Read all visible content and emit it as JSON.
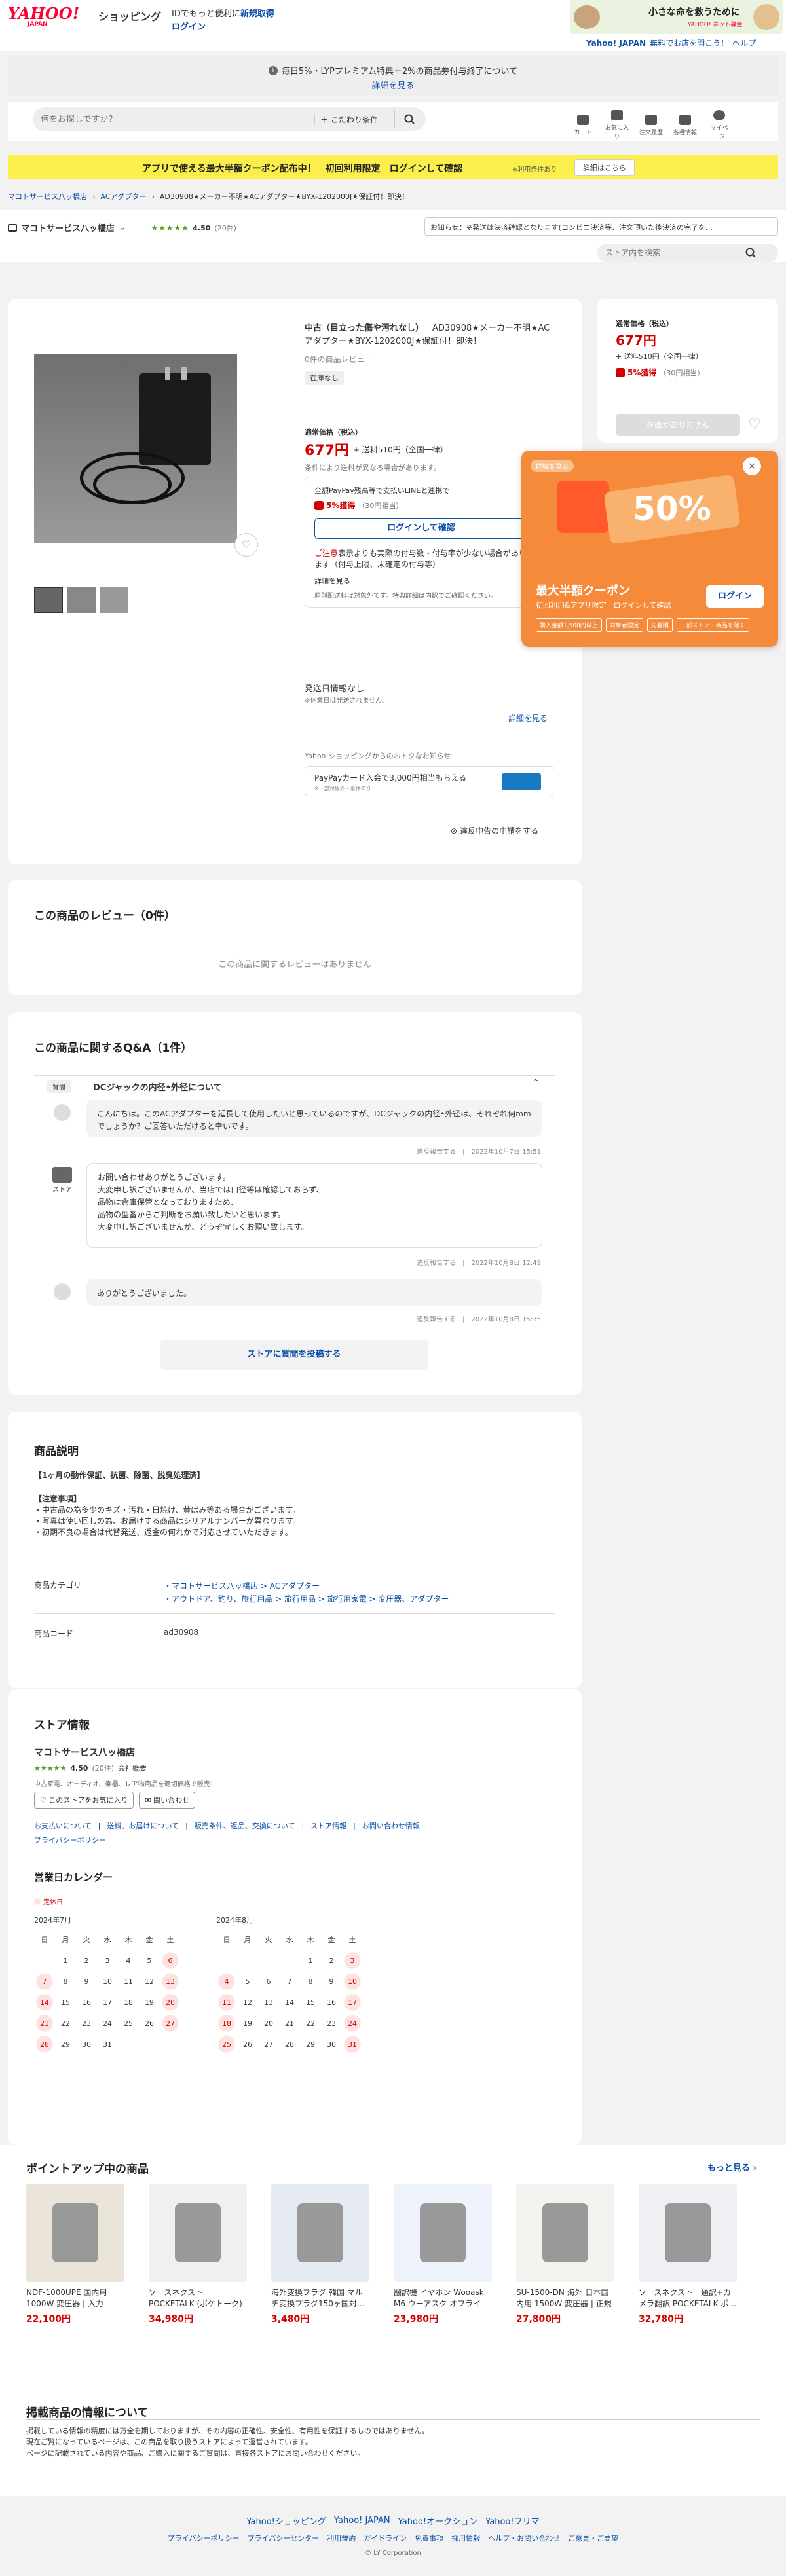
{
  "header": {
    "logo_main": "YAHOO!",
    "logo_sub": "JAPAN",
    "logo_shop": "ショッピング",
    "promo_line1": "IDでもっと便利に",
    "promo_register": "新規取得",
    "promo_login": "ログイン",
    "banner_text": "小さな命を救うために",
    "banner_sub": "YAHOO! ネット募金",
    "top_links": [
      "Yahoo! JAPAN",
      "無料でお店を開こう！",
      "ヘルプ"
    ]
  },
  "notice": {
    "text": "毎日5%・LYPプレミアム特典＋2%の商品券付与終了について",
    "link": "詳細を見る"
  },
  "search": {
    "placeholder": "何をお探しですか？",
    "cond": "こだわり条件",
    "icons": [
      {
        "name": "cart-icon",
        "label": "カート"
      },
      {
        "name": "heart-icon",
        "label": "お気に入り"
      },
      {
        "name": "history-icon",
        "label": "注文履歴"
      },
      {
        "name": "bell-icon",
        "label": "各種情報"
      },
      {
        "name": "user-icon",
        "label": "マイページ"
      }
    ]
  },
  "coupon_bar": {
    "text": "アプリで使える最大半額クーポン配布中！　初回利用限定　ログインして確認",
    "note": "※利用条件あり",
    "button": "詳細はこちら"
  },
  "breadcrumb": [
    "マコトサービス八ッ橋店",
    "ACアダプター",
    "AD30908★メーカー不明★ACアダプター★BYX-1202000J★保証付！即決！"
  ],
  "store_bar": {
    "name": "マコトサービス八ッ橋店",
    "rating": "4.50",
    "reviews": "(20件)",
    "notice": "お知らせ：※発送は決済確認となります(コンビニ決済等、注文頂いた後決済の完了を…",
    "store_search": "ストア内を検索"
  },
  "product": {
    "title_prefix": "中古（目立った傷や汚れなし）",
    "title": "AD30908★メーカー不明★ACアダプター★BYX-1202000J★保証付！即決！",
    "reviews": "0件の商品レビュー",
    "tag": "在庫なし",
    "price_label": "通常価格（税込）",
    "price": "677円",
    "shipping": "+ 送料510円（全国一律）",
    "ship_note": "条件により送料が異なる場合があります。",
    "pay_note": "全額PayPay残高等で支払いLINEと連携で",
    "pay_pct": "5%獲得",
    "pay_pts": "（30円相当）",
    "login_btn": "ログインして確認",
    "caution_label": "ご注意",
    "caution": "表示よりも実際の付与数・付与率が少ない場合があります（付与上限、未確定の付与等）",
    "caution_link": "詳細を見る",
    "exclude": "原則配送料は対象外です。特典詳細は内訳でご確認ください。",
    "ship_date": "発送日情報なし",
    "ship_date_note": "※休業日は発送されません。",
    "detail_link": "詳細を見る",
    "deal_label": "Yahoo!ショッピングからのおトクなお知らせ",
    "deal": "PayPayカード入会で3,000円相当もらえる",
    "deal_sub": "※一部対象外・条件あり",
    "report": "違反申告の申請をする"
  },
  "side_price": {
    "label": "通常価格（税込）",
    "price": "677円",
    "shipping": "+ 送料510円（全国一律）",
    "pct": "5%獲得",
    "pts": "（30円相当）",
    "btn": "在庫がありません"
  },
  "popup": {
    "tag": "詳細を見る",
    "pct": "50%",
    "title": "最大半額クーポン",
    "sub": "初回利用&アプリ限定　ログインして確認",
    "login": "ログイン",
    "chips": [
      "購入金額1,500円以上",
      "対象者限定",
      "先着順",
      "一部ストア・商品を除く"
    ]
  },
  "reviews_sec": {
    "title": "この商品のレビュー（0件）",
    "empty": "この商品に関するレビューはありません"
  },
  "qa": {
    "title": "この商品に関するQ&A（1件）",
    "q_tag": "質問",
    "q_title": "DCジャックの内径•外径について",
    "q_text": "こんにちは。このACアダプターを延長して使用したいと思っているのですが、DCジャックの内径•外径は、それぞれ何mmでしょうか？ご回答いただけると幸いです。",
    "q_meta": "違反報告する　|　2022年10月7日 15:51",
    "store_label": "ストア",
    "a_lines": [
      "お問い合わせありがとうございます。",
      "大変申し訳ございませんが、当店では口径等は確認しておらず、",
      "品物は倉庫保管となっておりますため、",
      "品物の型番からご判断をお願い致したいと思います。",
      "大変申し訳ございませんが、どうぞ宜しくお願い致します。"
    ],
    "a_meta": "違反報告する　|　2022年10月8日 12:49",
    "reply": "ありがとうございました。",
    "reply_meta": "違反報告する　|　2022年10月8日 15:35",
    "post_btn": "ストアに質問を投稿する"
  },
  "desc": {
    "title": "商品説明",
    "warranty": "【1ヶ月の動作保証、抗菌、除菌、脱臭処理済】",
    "notes_title": "【注意事項】",
    "notes": [
      "・中古品の為多少のキズ・汚れ・日焼け、黄ばみ等ある場合がございます。",
      "・写真は使い回しの為、お届けする商品はシリアルナンバーが異なります。",
      "・初期不良の場合は代替発送、返金の何れかで対応させていただきます。"
    ],
    "cat_label": "商品カテゴリ",
    "cats": [
      "マコトサービス八ッ橋店 > ACアダプター",
      "アウトドア、釣り、旅行用品 > 旅行用品 > 旅行用家電 > 変圧器、アダプター"
    ],
    "code_label": "商品コード",
    "code": "ad30908"
  },
  "store_info": {
    "title": "ストア情報",
    "name": "マコトサービス八ッ橋店",
    "rating": "4.50",
    "reviews": "(20件)",
    "type": "会社概要",
    "desc": "中古家電、オーディオ、楽器、レア物商品を適切価格で販売！",
    "fav": "このストアをお気に入り",
    "contact": "問い合わせ",
    "links": [
      "お支払いについて",
      "送料、お届けについて",
      "販売条件、返品、交換について",
      "ストア情報",
      "お問い合わせ情報"
    ],
    "privacy": "プライバシーポリシー"
  },
  "calendar": {
    "title": "営業日カレンダー",
    "legend": "定休日",
    "months": [
      {
        "name": "2024年7月",
        "days": [
          "",
          "1",
          "2",
          "3",
          "4",
          "5",
          "6",
          "7",
          "8",
          "9",
          "10",
          "11",
          "12",
          "13",
          "14",
          "15",
          "16",
          "17",
          "18",
          "19",
          "20",
          "21",
          "22",
          "23",
          "24",
          "25",
          "26",
          "27",
          "28",
          "29",
          "30",
          "31"
        ],
        "red": [
          "6",
          "7",
          "13",
          "14",
          "20",
          "21",
          "27",
          "28"
        ]
      },
      {
        "name": "2024年8月",
        "days": [
          "",
          "",
          "",
          "",
          "1",
          "2",
          "3",
          "4",
          "5",
          "6",
          "7",
          "8",
          "9",
          "10",
          "11",
          "12",
          "13",
          "14",
          "15",
          "16",
          "17",
          "18",
          "19",
          "20",
          "21",
          "22",
          "23",
          "24",
          "25",
          "26",
          "27",
          "28",
          "29",
          "30",
          "31"
        ],
        "red": [
          "3",
          "4",
          "10",
          "11",
          "17",
          "18",
          "24",
          "25",
          "31"
        ]
      }
    ],
    "dow": [
      "日",
      "月",
      "火",
      "水",
      "木",
      "金",
      "土"
    ]
  },
  "points": {
    "title": "ポイントアップ中の商品",
    "more": "もっと見る",
    "items": [
      {
        "name": "NDF-1000UPE 国内用 1000W 変圧器 | 入力 100V 出力…",
        "price": "22,100円"
      },
      {
        "name": "ソースネクスト　POCKETALK (ポケトーク) S Plus グ…",
        "price": "34,980円"
      },
      {
        "name": "海外変換プラグ 韓国 マルチ変換プラグ150ヶ国対…",
        "price": "3,480円"
      },
      {
        "name": "翻訳機 イヤホン Wooask M6 ウーアスク オフライン…",
        "price": "23,980円"
      },
      {
        "name": "SU-1500-DN 海外 日本国内用 1500W 変圧器 | 正規代…",
        "price": "27,800円"
      },
      {
        "name": "ソースネクスト　通訳+カメラ翻訳 POCKETALK ポ…",
        "price": "32,780円"
      }
    ]
  },
  "disclaimer": {
    "title": "掲載商品の情報について",
    "lines": [
      "掲載している情報の精度には万全を期しておりますが、その内容の正確性、安全性、有用性を保証するものではありません。",
      "現在ご覧になっているページは、この商品を取り扱うストアによって運営されています。",
      "ページに記載されている内容や商品、ご購入に関するご質問は、直接各ストアにお問い合わせください。"
    ]
  },
  "footer": {
    "links1": [
      "Yahoo!ショッピング",
      "Yahoo! JAPAN",
      "Yahoo!オークション",
      "Yahoo!フリマ"
    ],
    "links2": [
      "プライバシーポリシー",
      "プライバシーセンター",
      "利用規約",
      "ガイドライン",
      "免責事項",
      "採用情報",
      "ヘルプ・お問い合わせ",
      "ご意見・ご要望"
    ],
    "copy": "© LY Corporation"
  },
  "colors": {
    "accent": "#d40000",
    "link": "#0a4fa8",
    "yellow": "#fcef4b",
    "orange": "#f58a3a",
    "green": "#52a12b"
  }
}
